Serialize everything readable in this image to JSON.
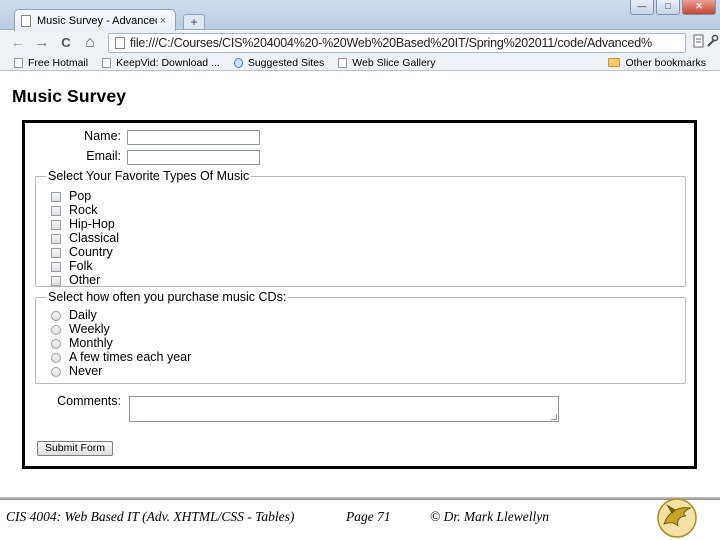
{
  "browser": {
    "tab_title": "Music Survey - Advanced...",
    "tab_close": "×",
    "new_tab": "+",
    "window_controls": {
      "minimize": "—",
      "maximize": "□",
      "close": "✕"
    },
    "nav": {
      "back": "←",
      "forward": "→",
      "reload": "C",
      "home": "⌂"
    },
    "url": "file:///C:/Courses/CIS%204004%20-%20Web%20Based%20IT/Spring%202011/code/Advanced%",
    "bookmarks": [
      "Free Hotmail",
      "KeepVid: Download ...",
      "Suggested Sites",
      "Web Slice Gallery"
    ],
    "other_bookmarks": "Other bookmarks"
  },
  "page": {
    "title": "Music Survey"
  },
  "form": {
    "name_label": "Name:",
    "email_label": "Email:",
    "music_legend": "Select Your Favorite Types Of Music",
    "music_options": [
      "Pop",
      "Rock",
      "Hip-Hop",
      "Classical",
      "Country",
      "Folk",
      "Other"
    ],
    "frequency_legend": "Select how often you purchase music CDs:",
    "frequency_options": [
      "Daily",
      "Weekly",
      "Monthly",
      "A few times each year",
      "Never"
    ],
    "comments_label": "Comments:",
    "submit_label": "Submit Form"
  },
  "footer": {
    "course": "CIS 4004: Web Based IT (Adv. XHTML/CSS - Tables)",
    "page": "Page 71",
    "author": "© Dr. Mark Llewellyn"
  },
  "colors": {
    "chrome": "#c4d4e8",
    "form_border": "#000000",
    "fieldset_border": "#b8b8b8",
    "logo_gold": "#c9a227"
  }
}
